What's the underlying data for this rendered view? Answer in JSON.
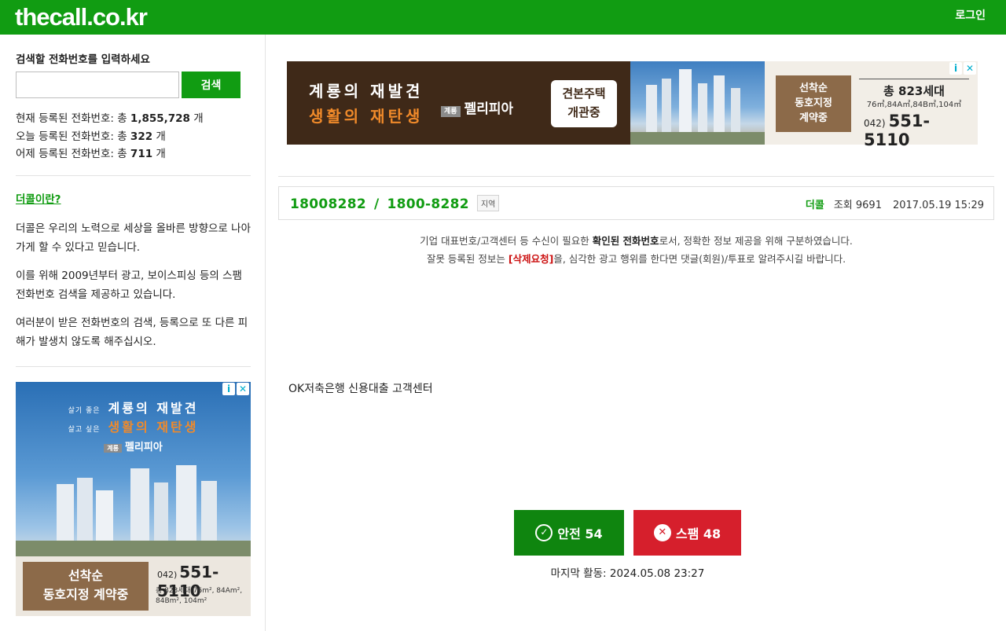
{
  "header": {
    "logo": "thecall.co.kr",
    "login_label": "로그인"
  },
  "sidebar": {
    "search_title": "검색할 전화번호를 입력하세요",
    "search_value": "",
    "search_button": "검색",
    "stats": [
      {
        "label": "현재 등록된 전화번호: 총",
        "value": "1,855,728",
        "unit": "개"
      },
      {
        "label": "오늘 등록된 전화번호: 총",
        "value": "322",
        "unit": "개"
      },
      {
        "label": "어제 등록된 전화번호: 총",
        "value": "711",
        "unit": "개"
      }
    ],
    "about_link": "더콜이란?",
    "about_paragraphs": [
      "더콜은 우리의 노력으로 세상을 올바른 방향으로 나아가게 할 수 있다고 믿습니다.",
      "이를 위해 2009년부터 광고, 보이스피싱 등의 스팸 전화번호 검색을 제공하고 있습니다.",
      "여러분이 받은 전화번호의 검색, 등록으로 또 다른 피해가 발생치 않도록 해주십시오."
    ],
    "ad": {
      "line1_small": "살기 좋은",
      "line1": "계룡의 재발견",
      "line2_small": "살고 싶은",
      "line2": "생활의 재탄생",
      "brand_tag": "계룡",
      "brand": "펠리피아",
      "box": [
        "선착순",
        "동호지정 계약중"
      ],
      "phone_prefix": "042)",
      "phone": "551-5110",
      "units": "총 823세대 76m², 84Am², 84Bm², 104m²"
    }
  },
  "top_ad": {
    "line1": "계룡의 재발견",
    "line2": "생활의 재탄생",
    "brand_tag": "계룡",
    "brand": "펠리피아",
    "model_house": [
      "견본주택",
      "개관중"
    ],
    "box": [
      "선착순",
      "동호지정",
      "계약중"
    ],
    "total": "총 823세대",
    "units": "76㎡,84A㎡,84B㎡,104㎡",
    "phone_prefix": "042)",
    "phone": "551-5110"
  },
  "number": {
    "raw": "18008282",
    "separator": "/",
    "formatted": "1800-8282",
    "region_tag": "지역",
    "source": "더콜",
    "views": "조회 9691",
    "date": "2017.05.19 15:29"
  },
  "notice": {
    "line1_pre": "기업 대표번호/고객센터 등 수신이 필요한 ",
    "line1_bold": "확인된 전화번호",
    "line1_post": "로서, 정확한 정보 제공을 위해 구분하였습니다.",
    "line2_pre": "잘못 등록된 정보는 ",
    "line2_link": "[삭제요청]",
    "line2_post": "을, 심각한 광고 행위를 한다면 댓글(회원)/투표로 알려주시길 바랍니다."
  },
  "comment": "OK저축은행 신용대출 고객센터",
  "votes": {
    "safe_label": "안전 54",
    "spam_label": "스팸 48",
    "last_activity": "마지막 활동: 2024.05.08 23:27"
  },
  "colors": {
    "brand_green": "#119c12",
    "safe_green": "#0f850f",
    "spam_red": "#d61f2c"
  }
}
